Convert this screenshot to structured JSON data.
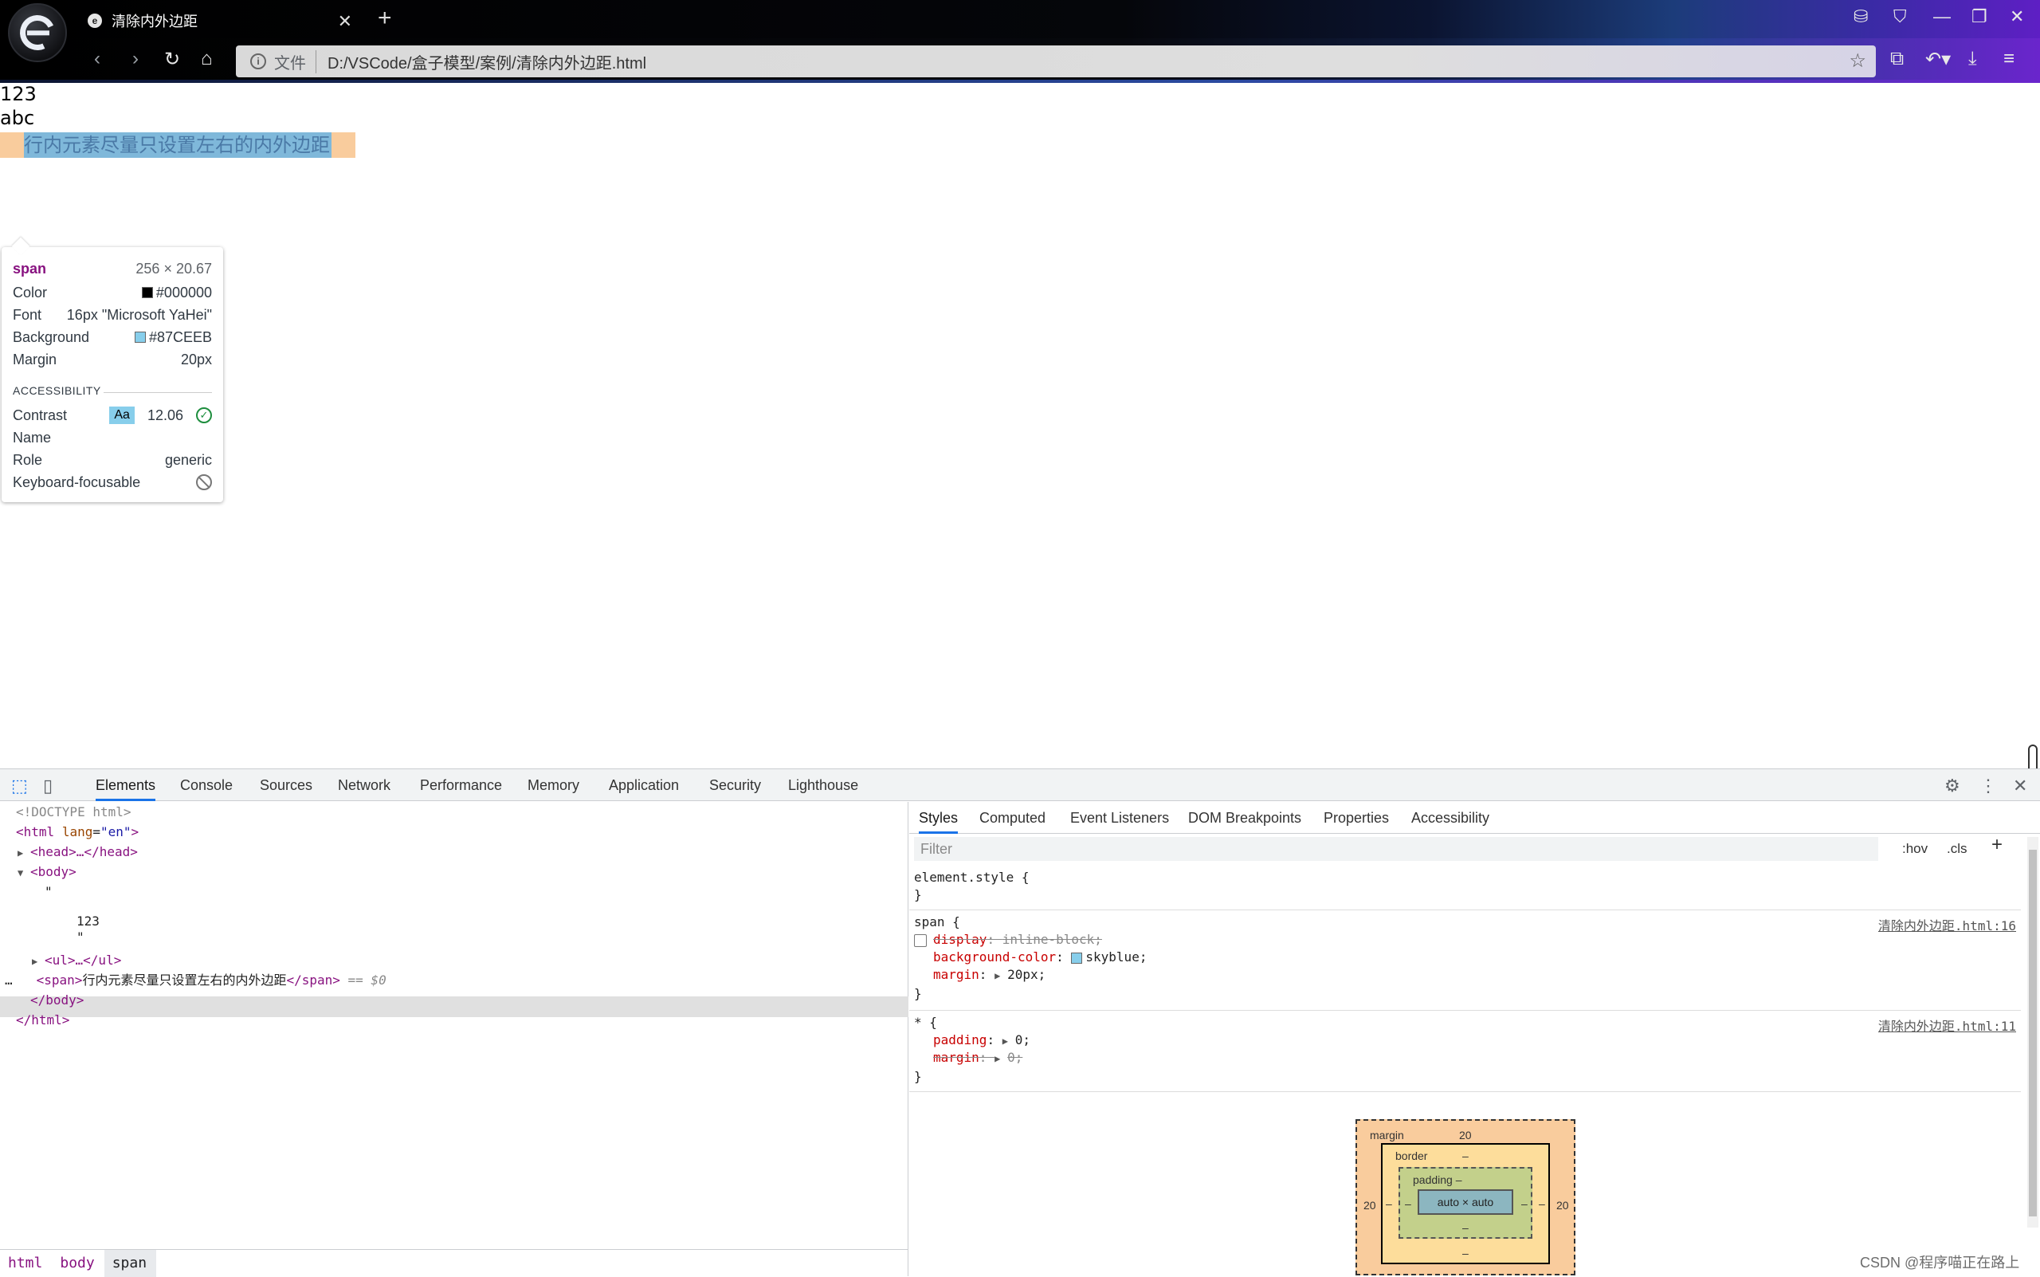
{
  "browser": {
    "tab_title": "清除内外边距",
    "tab_favicon": "e",
    "address_scheme": "文件",
    "address_url": "D:/VSCode/盒子模型/案例/清除内外边距.html",
    "icons": [
      "back-icon",
      "forward-icon",
      "reload-icon",
      "home-icon",
      "star-icon",
      "extensions-icon",
      "undo-icon",
      "download-icon",
      "collections-icon",
      "minimize-icon",
      "maximize-icon",
      "close-icon"
    ]
  },
  "page": {
    "line1": "123",
    "line2": "abc",
    "span_text": "行内元素尽量只设置左右的内外边距",
    "span_bg": "#87CEEB",
    "margin_color": "#F9CC9D"
  },
  "tooltip": {
    "tag": "span",
    "size": "256 × 20.67",
    "color_label": "Color",
    "color_value": "#000000",
    "font_label": "Font",
    "font_value": "16px \"Microsoft YaHei\"",
    "background_label": "Background",
    "background_value": "#87CEEB",
    "margin_label": "Margin",
    "margin_value": "20px",
    "section": "ACCESSIBILITY",
    "contrast_label": "Contrast",
    "contrast_sample": "Aa",
    "contrast_value": "12.06",
    "name_label": "Name",
    "role_label": "Role",
    "role_value": "generic",
    "keyboard_label": "Keyboard-focusable"
  },
  "devtools": {
    "tabs": [
      "Elements",
      "Console",
      "Sources",
      "Network",
      "Performance",
      "Memory",
      "Application",
      "Security",
      "Lighthouse"
    ],
    "active_tab": "Elements",
    "dom": {
      "doctype": "<!DOCTYPE html>",
      "html_open_tag": "<html",
      "html_attr": "lang",
      "html_attr_val": "\"en\"",
      "head": "<head>…</head>",
      "body_open": "<body>",
      "quote1": "\"",
      "text_123": "123",
      "quote2": "\"",
      "ul": "<ul>…</ul>",
      "span_open": "<span>",
      "span_text": "行内元素尽量只设置左右的内外边距",
      "span_close": "</span>",
      "dollar": "== $0",
      "ellipsis": "…",
      "body_close": "</body>",
      "html_close": "</html>"
    },
    "breadcrumbs": [
      "html",
      "body",
      "span"
    ],
    "styles_tabs": [
      "Styles",
      "Computed",
      "Event Listeners",
      "DOM Breakpoints",
      "Properties",
      "Accessibility"
    ],
    "filter_placeholder": "Filter",
    "hov": ":hov",
    "cls": ".cls",
    "plus": "+",
    "rules": {
      "element_style_open": "element.style {",
      "close": "}",
      "span_selector": "span {",
      "span_source": "清除内外边距.html:16",
      "display_prop": "display",
      "display_val": "inline-block;",
      "bg_prop": "background-color",
      "bg_val": "skyblue;",
      "margin_prop": "margin",
      "margin_val": "20px;",
      "star_selector": "* {",
      "star_source": "清除内外边距.html:11",
      "padding_prop": "padding",
      "padding_val": "0;",
      "margin2_prop": "margin",
      "margin2_val": "0;"
    },
    "box_model": {
      "margin_label": "margin",
      "margin_top": "20",
      "margin_left": "20",
      "margin_right": "20",
      "border_label": "border",
      "border_top": "–",
      "border_left": "–",
      "border_right": "–",
      "border_bottom": "–",
      "padding_label": "padding –",
      "padding_left": "–",
      "padding_right": "–",
      "padding_bottom": "–",
      "content": "auto × auto"
    }
  },
  "watermark": "CSDN @程序喵正在路上"
}
